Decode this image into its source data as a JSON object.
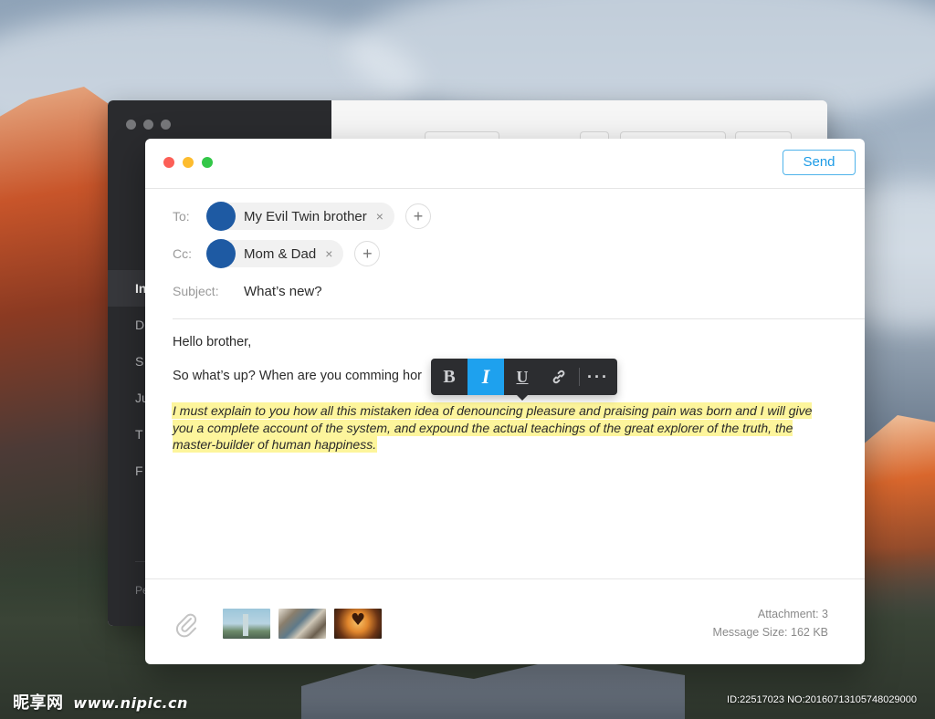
{
  "wallpaper": {
    "watermark_left": "昵享网",
    "watermark_url": "www.nipic.cn",
    "watermark_id": "ID:22517023 NO:20160713105748029000"
  },
  "background_window": {
    "nav_items": [
      "In",
      "D",
      "S",
      "Ju",
      "T",
      "F"
    ],
    "footer_text": "Pe"
  },
  "compose": {
    "send_label": "Send",
    "to": {
      "label": "To:",
      "recipient": "My Evil Twin brother",
      "remove_glyph": "×",
      "add_glyph": "+"
    },
    "cc": {
      "label": "Cc:",
      "recipient": "Mom & Dad",
      "remove_glyph": "×",
      "add_glyph": "+"
    },
    "subject": {
      "label": "Subject:",
      "value": "What’s new?"
    },
    "body": {
      "line1": "Hello brother,",
      "line2": "So what’s up? When are you comming hor",
      "highlighted": "I must explain to you how all this mistaken idea of denouncing pleasure and praising pain was born and I will give you a complete account of the system, and expound the actual teachings of the great explorer of the truth, the master-builder of human happiness."
    },
    "format_toolbar": {
      "bold": "B",
      "italic": "I",
      "underline": "U",
      "more": "···",
      "active": "italic"
    },
    "attachments": {
      "count_text": "Attachment: 3",
      "size_text": "Message Size: 162 KB"
    },
    "colors": {
      "accent": "#1ea1ee",
      "highlight": "#fdf59c",
      "avatar": "#1e5aa3"
    }
  }
}
